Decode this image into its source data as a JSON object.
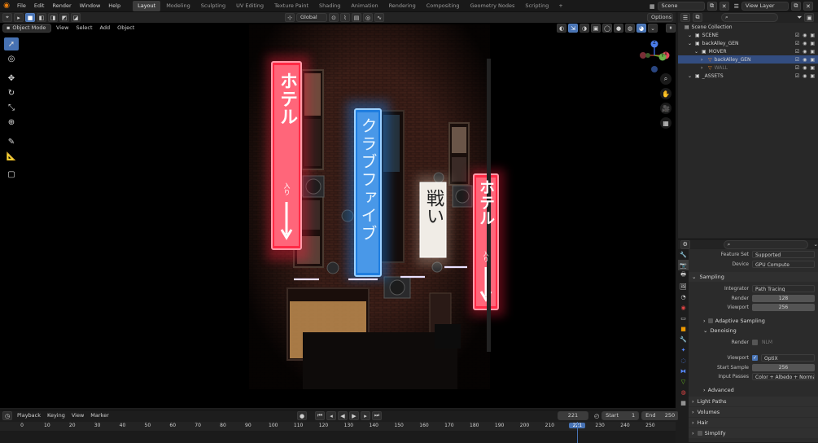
{
  "topbar": {
    "menus": [
      "File",
      "Edit",
      "Render",
      "Window",
      "Help"
    ],
    "workspaces": [
      "Layout",
      "Modeling",
      "Sculpting",
      "UV Editing",
      "Texture Paint",
      "Shading",
      "Animation",
      "Rendering",
      "Compositing",
      "Geometry Nodes",
      "Scripting"
    ],
    "active_workspace": "Layout",
    "add_tab": "+",
    "scene": "Scene",
    "view_layer": "View Layer"
  },
  "viewport": {
    "mode": "Object Mode",
    "menus": [
      "View",
      "Select",
      "Add",
      "Object"
    ],
    "transform_orientation": "Global",
    "options": "Options",
    "axis_labels": {
      "x": "X",
      "y": "Y",
      "z": "Z"
    }
  },
  "sign_text": {
    "hotel_left": "ホテル",
    "hotel_left_sub": "入り",
    "club": "クラブファイブ",
    "middle": "戦い",
    "hotel_right": "ホテル",
    "hotel_right_sub": "入り"
  },
  "outliner": {
    "root": "Scene Collection",
    "items": [
      {
        "label": "SCENE",
        "depth": 1
      },
      {
        "label": "backAlley_GEN",
        "depth": 1
      },
      {
        "label": "MOVER",
        "depth": 2
      },
      {
        "label": "backAlley_GEN",
        "depth": 3,
        "selected": true
      },
      {
        "label": "WALL",
        "depth": 3,
        "dim": true
      },
      {
        "label": "_ASSETS",
        "depth": 1
      }
    ]
  },
  "properties": {
    "feature_set_label": "Feature Set",
    "feature_set": "Supported",
    "device_label": "Device",
    "device": "GPU Compute",
    "sampling": "Sampling",
    "integrator_label": "Integrator",
    "integrator": "Path Tracing",
    "render_label": "Render",
    "render_samples": "128",
    "viewport_label": "Viewport",
    "viewport_samples": "256",
    "adaptive_sampling": "Adaptive Sampling",
    "denoising": "Denoising",
    "denoise_render_label": "Render",
    "denoise_render_value": "NLM",
    "denoise_viewport_label": "Viewport",
    "denoise_viewport_value": "OptiX",
    "start_sample_label": "Start Sample",
    "start_sample": "256",
    "input_passes_label": "Input Passes",
    "input_passes": "Color + Albedo + Normal",
    "advanced": "Advanced",
    "light_paths": "Light Paths",
    "volumes": "Volumes",
    "hair": "Hair",
    "simplify": "Simplify"
  },
  "timeline": {
    "menus": [
      "Playback",
      "Keying",
      "View",
      "Marker"
    ],
    "current_frame": "221",
    "start_label": "Start",
    "start": "1",
    "end_label": "End",
    "end": "250",
    "ticks": [
      "0",
      "10",
      "20",
      "30",
      "40",
      "50",
      "60",
      "70",
      "80",
      "90",
      "100",
      "110",
      "120",
      "130",
      "140",
      "150",
      "160",
      "170",
      "180",
      "190",
      "200",
      "210",
      "221",
      "230",
      "240",
      "250"
    ],
    "tick_values": [
      0,
      10,
      20,
      30,
      40,
      50,
      60,
      70,
      80,
      90,
      100,
      110,
      120,
      130,
      140,
      150,
      160,
      170,
      180,
      190,
      200,
      210,
      221,
      230,
      240,
      250
    ]
  },
  "colors": {
    "accent": "#4772b3",
    "neon_red": "#ff1e3c",
    "neon_blue": "#1e8cff",
    "window_amber": "#ffb060"
  }
}
